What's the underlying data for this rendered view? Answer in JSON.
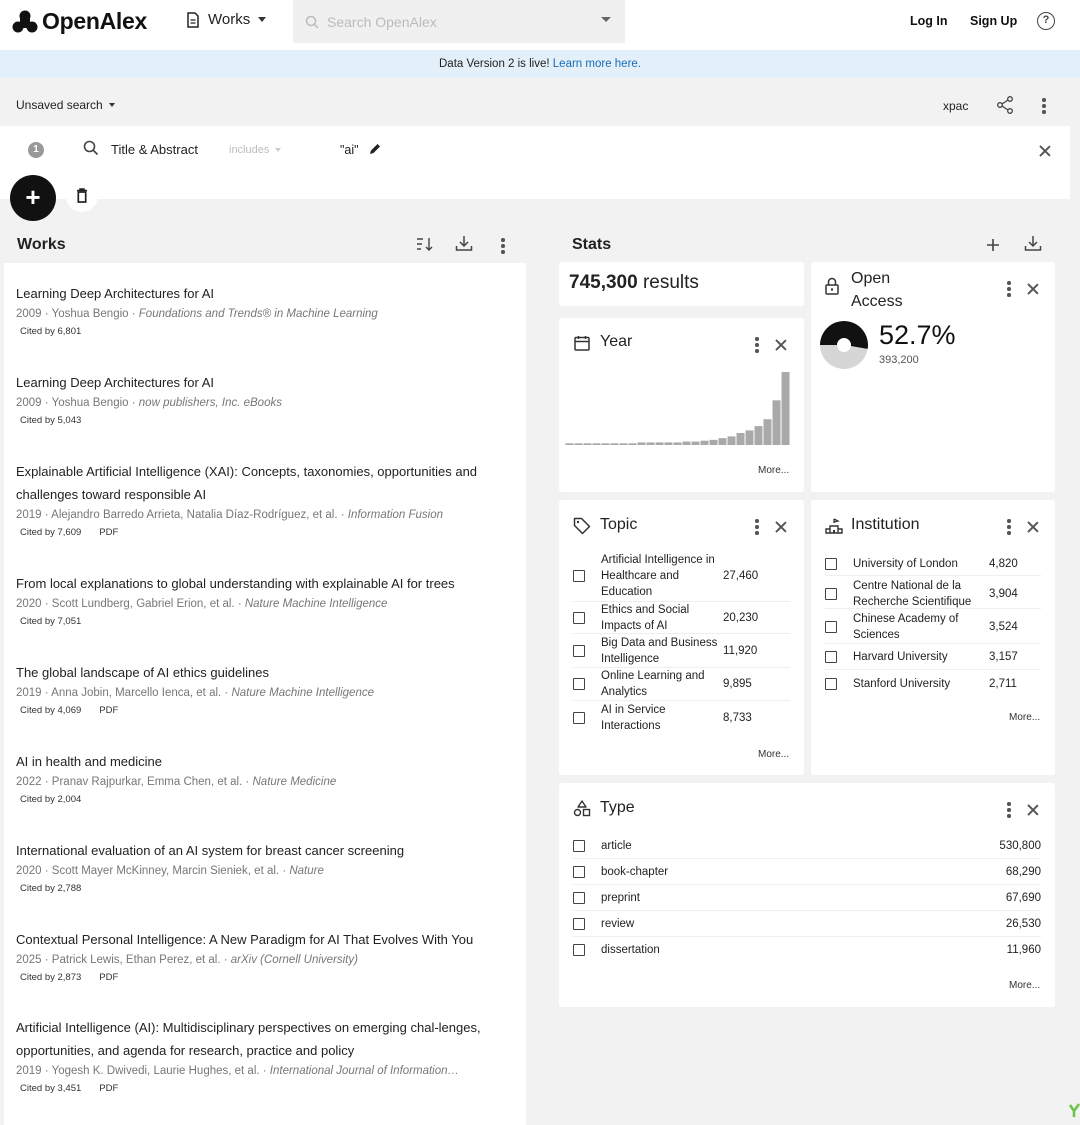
{
  "app": {
    "name": "OpenAlex"
  },
  "nav": {
    "entity": "Works",
    "search_placeholder": "Search OpenAlex",
    "login": "Log In",
    "signup": "Sign Up",
    "help": "?"
  },
  "banner": {
    "text": "Data Version 2 is live! ",
    "link": "Learn more here."
  },
  "search": {
    "name": "Unsaved search",
    "xpac": "xpac"
  },
  "filter": {
    "number": "1",
    "field": "Title & Abstract",
    "operator": "includes",
    "value": "\"ai\""
  },
  "works": {
    "title": "Works",
    "items": [
      {
        "title": "Learning Deep Architectures for AI",
        "meta": "2009 · Yoshua Bengio · ",
        "venue": "Foundations and Trends® in Machine Learning",
        "cited": "Cited by 6,801",
        "pdf": ""
      },
      {
        "title": "Learning Deep Architectures for AI",
        "meta": "2009 · Yoshua Bengio · ",
        "venue": "now publishers, Inc. eBooks",
        "cited": "Cited by 5,043",
        "pdf": ""
      },
      {
        "title": "Explainable Artificial Intelligence (XAI): Concepts, taxonomies, opportunities and challenges toward responsible AI",
        "meta": "2019 · Alejandro Barredo Arrieta, Natalia Díaz-Rodríguez, et al. · ",
        "venue": "Information Fusion",
        "cited": "Cited by 7,609",
        "pdf": "PDF"
      },
      {
        "title": "From local explanations to global understanding with explainable AI for trees",
        "meta": "2020 · Scott Lundberg, Gabriel Erion, et al. · ",
        "venue": "Nature Machine Intelligence",
        "cited": "Cited by 7,051",
        "pdf": ""
      },
      {
        "title": "The global landscape of AI ethics guidelines",
        "meta": "2019 · Anna Jobin, Marcello Ienca, et al. · ",
        "venue": "Nature Machine Intelligence",
        "cited": "Cited by 4,069",
        "pdf": "PDF"
      },
      {
        "title": "AI in health and medicine",
        "meta": "2022 · Pranav Rajpurkar, Emma Chen, et al. · ",
        "venue": "Nature Medicine",
        "cited": "Cited by 2,004",
        "pdf": ""
      },
      {
        "title": "International evaluation of an AI system for breast cancer screening",
        "meta": "2020 · Scott Mayer McKinney, Marcin Sieniek, et al. · ",
        "venue": "Nature",
        "cited": "Cited by 2,788",
        "pdf": ""
      },
      {
        "title": "Contextual Personal Intelligence: A New Paradigm for AI That Evolves With You",
        "meta": "2025 · Patrick Lewis, Ethan Perez, et al. · ",
        "venue": "arXiv (Cornell University)",
        "cited": "Cited by 2,873",
        "pdf": "PDF"
      },
      {
        "title": "Artificial Intelligence (AI): Multidisciplinary perspectives on emerging chal-lenges, opportunities, and agenda for research, practice and policy",
        "meta": "2019 · Yogesh K. Dwivedi, Laurie Hughes, et al. · ",
        "venue": "International Journal of Information…",
        "cited": "Cited by 3,451",
        "pdf": "PDF"
      }
    ]
  },
  "stats": {
    "title": "Stats",
    "results": {
      "count": "745,300",
      "label": " results"
    },
    "open_access": {
      "title_line1": "Open",
      "title_line2": "Access",
      "percent": "52.7%",
      "percent_value": 52.7,
      "count": "393,200"
    },
    "year": {
      "title": "Year",
      "more": "More...",
      "histogram": [
        2,
        2,
        2,
        2,
        2,
        2,
        2,
        2,
        3,
        3,
        3,
        3,
        3,
        4,
        4,
        5,
        6,
        8,
        10,
        14,
        17,
        22,
        30,
        52,
        85
      ],
      "colors": {
        "bar": "#a9a9a9"
      }
    },
    "topic": {
      "title": "Topic",
      "more": "More...",
      "items": [
        {
          "label": "Artificial Intelligence in Healthcare and Education",
          "count": "27,460"
        },
        {
          "label": "Ethics and Social Impacts of AI",
          "count": "20,230"
        },
        {
          "label": "Big Data and Business Intelligence",
          "count": "11,920"
        },
        {
          "label": "Online Learning and Analytics",
          "count": "9,895"
        },
        {
          "label": "AI in Service Interactions",
          "count": "8,733"
        }
      ]
    },
    "institution": {
      "title": "Institution",
      "more": "More...",
      "items": [
        {
          "label": "University of London",
          "count": "4,820"
        },
        {
          "label": "Centre National de la Recherche Scientifique",
          "count": "3,904"
        },
        {
          "label": "Chinese Academy of Sciences",
          "count": "3,524"
        },
        {
          "label": "Harvard University",
          "count": "3,157"
        },
        {
          "label": "Stanford University",
          "count": "2,711"
        }
      ]
    },
    "type": {
      "title": "Type",
      "more": "More...",
      "items": [
        {
          "label": "article",
          "count": "530,800"
        },
        {
          "label": "book-chapter",
          "count": "68,290"
        },
        {
          "label": "preprint",
          "count": "67,690"
        },
        {
          "label": "review",
          "count": "26,530"
        },
        {
          "label": "dissertation",
          "count": "11,960"
        }
      ]
    }
  },
  "colors": {
    "accent": "#1a6bb5",
    "banner_bg": "#e3f0fa",
    "oa_dark": "#111111",
    "oa_light": "#d6d6d6"
  }
}
